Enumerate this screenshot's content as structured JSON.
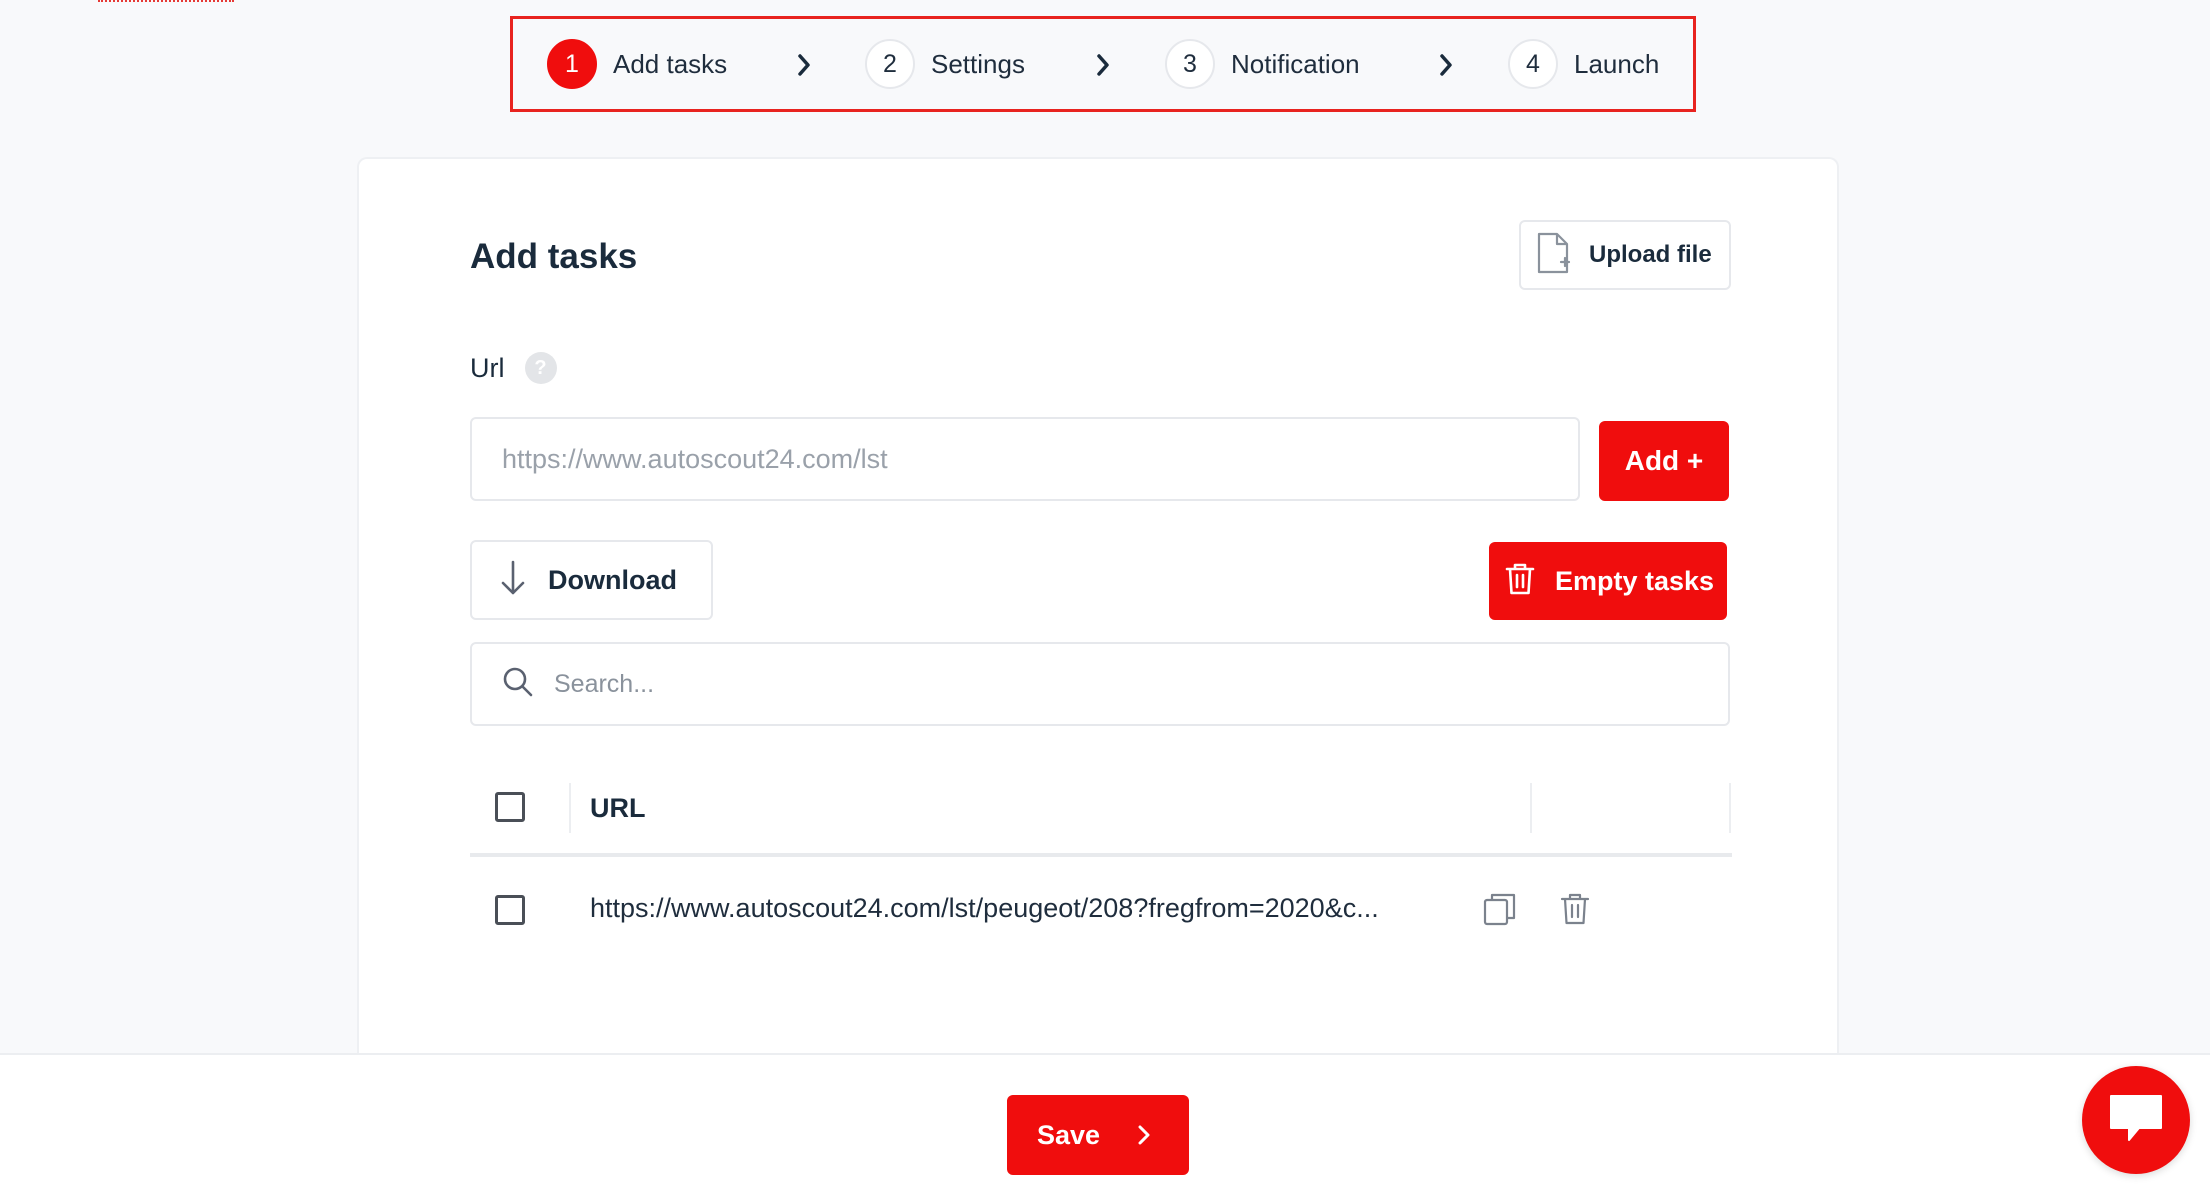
{
  "stepper": {
    "steps": [
      {
        "number": "1",
        "label": "Add tasks",
        "active": true
      },
      {
        "number": "2",
        "label": "Settings",
        "active": false
      },
      {
        "number": "3",
        "label": "Notification",
        "active": false
      },
      {
        "number": "4",
        "label": "Launch",
        "active": false
      }
    ],
    "highlight_color": "#e8231f"
  },
  "page": {
    "title": "Add tasks",
    "upload_label": "Upload file"
  },
  "url_field": {
    "label": "Url",
    "help_icon": "?",
    "placeholder": "https://www.autoscout24.com/lst",
    "add_label": "Add +"
  },
  "actions": {
    "download_label": "Download",
    "empty_label": "Empty tasks"
  },
  "search": {
    "placeholder": "Search..."
  },
  "table": {
    "header_url": "URL",
    "rows": [
      {
        "url": "https://www.autoscout24.com/lst/peugeot/208?fregfrom=2020&c..."
      }
    ]
  },
  "footer": {
    "save_label": "Save"
  },
  "colors": {
    "accent": "#f00d0d",
    "text": "#1a2b3c",
    "border": "#e6e8ec"
  }
}
